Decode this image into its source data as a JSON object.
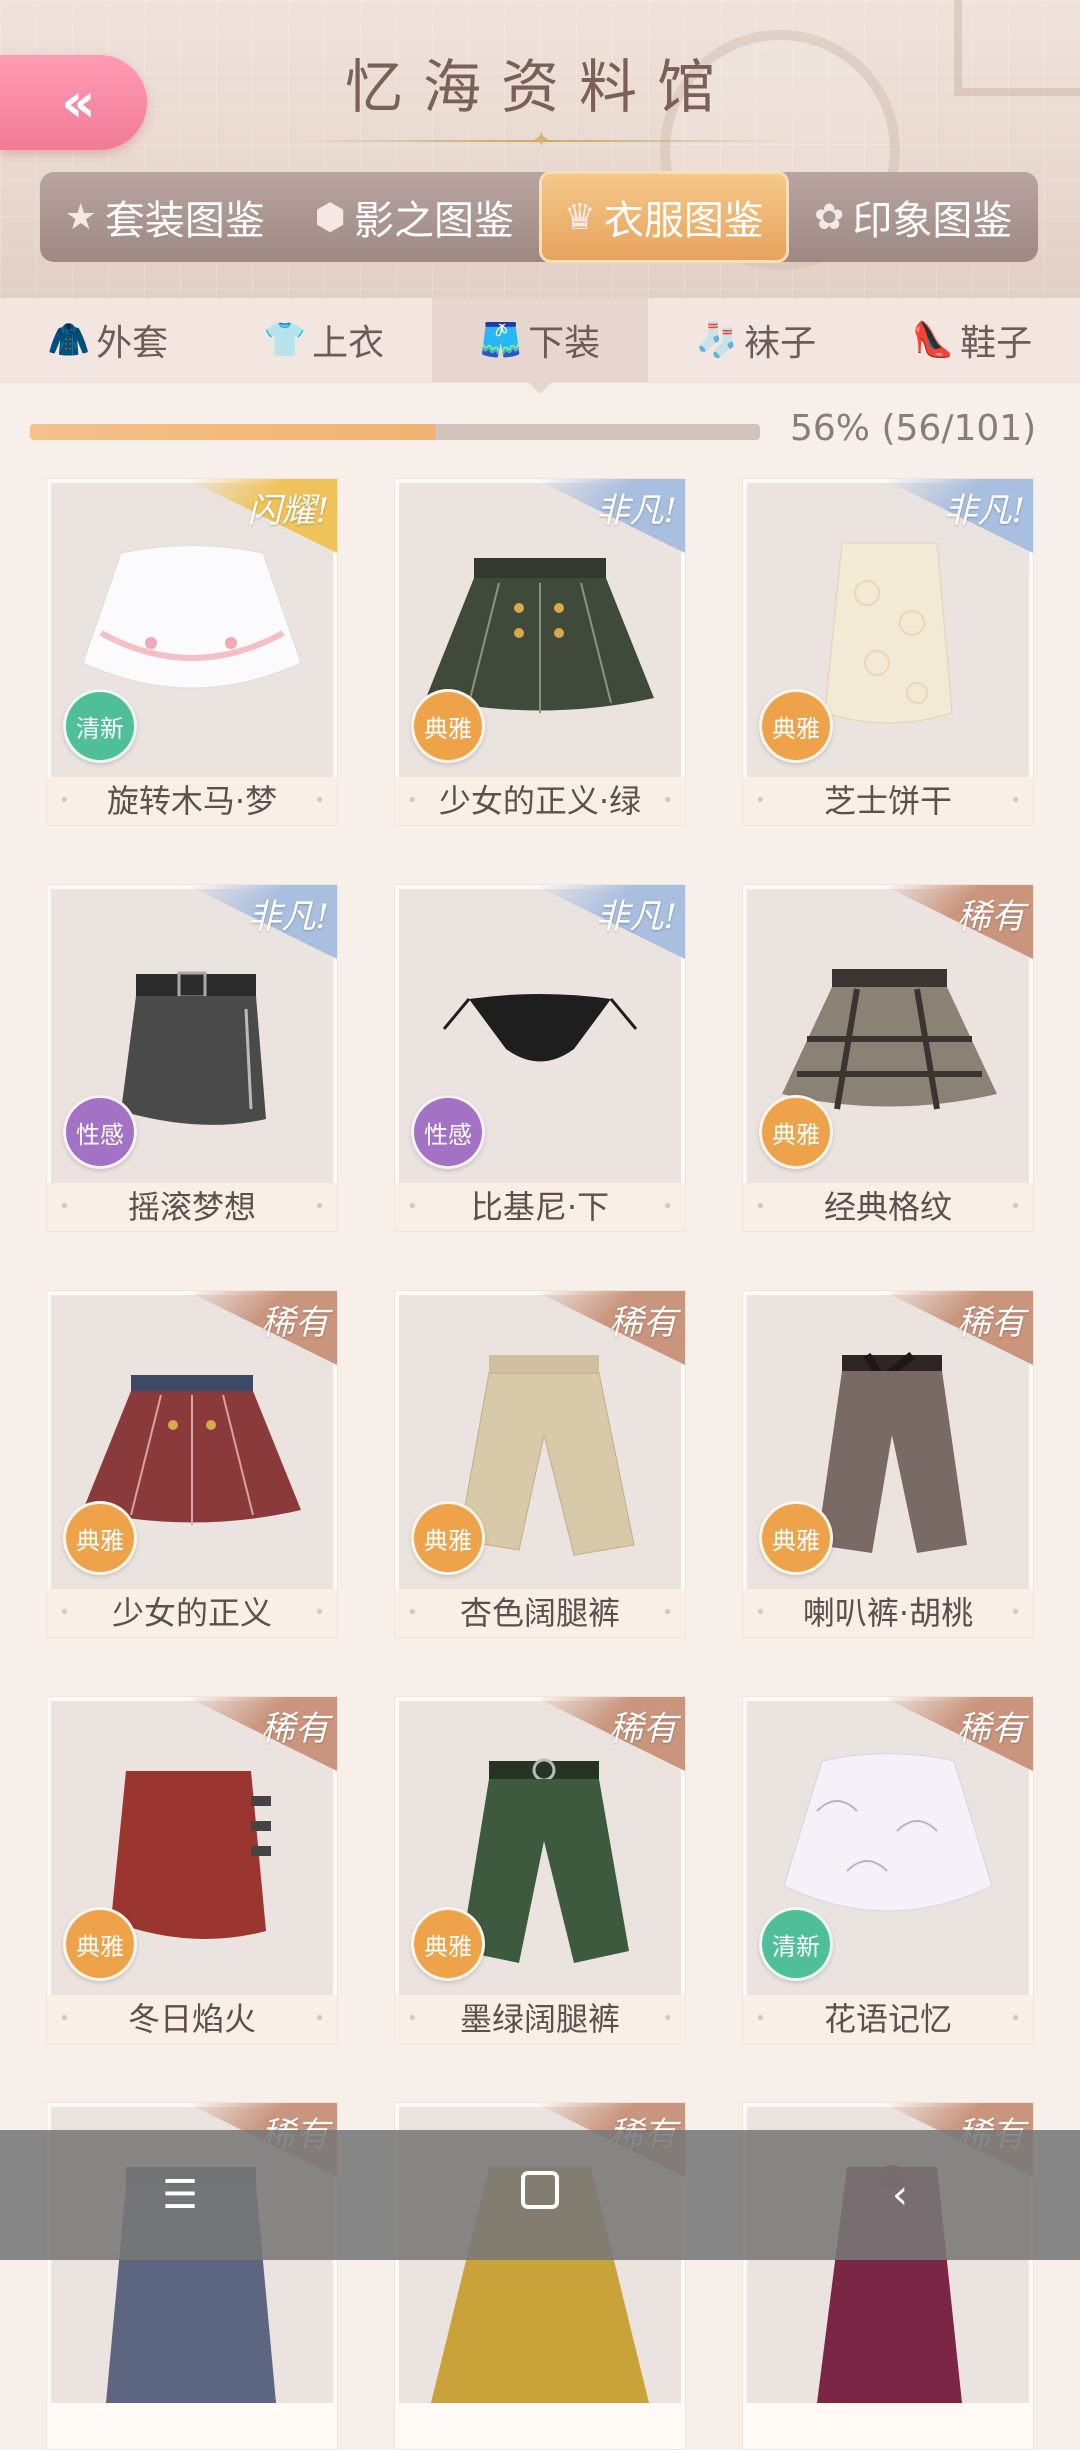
{
  "header": {
    "title": "忆海资料馆",
    "back_icon": "double-chevron-left-icon"
  },
  "category_tabs": [
    {
      "label": "套装图鉴",
      "icon": "star-icon",
      "active": false
    },
    {
      "label": "影之图鉴",
      "icon": "cube-icon",
      "active": false
    },
    {
      "label": "衣服图鉴",
      "icon": "dress-icon",
      "active": true
    },
    {
      "label": "印象图鉴",
      "icon": "flower-icon",
      "active": false
    }
  ],
  "sub_tabs": [
    {
      "label": "外套",
      "icon": "coat-icon"
    },
    {
      "label": "上衣",
      "icon": "shirt-icon"
    },
    {
      "label": "下装",
      "icon": "shorts-icon",
      "active": true
    },
    {
      "label": "袜子",
      "icon": "sock-icon"
    },
    {
      "label": "鞋子",
      "icon": "shoe-icon"
    }
  ],
  "progress": {
    "text": "56% (56/101)",
    "fraction": 0.5545
  },
  "items": [
    {
      "name": "旋转木马·梦",
      "rarity": "闪耀!",
      "style": "清新"
    },
    {
      "name": "少女的正义·绿",
      "rarity": "非凡!",
      "style": "典雅"
    },
    {
      "name": "芝士饼干",
      "rarity": "非凡!",
      "style": "典雅"
    },
    {
      "name": "摇滚梦想",
      "rarity": "非凡!",
      "style": "性感"
    },
    {
      "name": "比基尼·下",
      "rarity": "非凡!",
      "style": "性感"
    },
    {
      "name": "经典格纹",
      "rarity": "稀有",
      "style": "典雅"
    },
    {
      "name": "少女的正义",
      "rarity": "稀有",
      "style": "典雅"
    },
    {
      "name": "杏色阔腿裤",
      "rarity": "稀有",
      "style": "典雅"
    },
    {
      "name": "喇叭裤·胡桃",
      "rarity": "稀有",
      "style": "典雅"
    },
    {
      "name": "冬日焰火",
      "rarity": "稀有",
      "style": "典雅"
    },
    {
      "name": "墨绿阔腿裤",
      "rarity": "稀有",
      "style": "典雅"
    },
    {
      "name": "花语记忆",
      "rarity": "稀有",
      "style": "清新"
    },
    {
      "name": "",
      "rarity": "稀有",
      "style": ""
    },
    {
      "name": "",
      "rarity": "稀有",
      "style": ""
    },
    {
      "name": "",
      "rarity": "稀有",
      "style": ""
    }
  ],
  "colors": {
    "rarity_shine": "#f0c35a",
    "rarity_extraordinary": "#a9bfe0",
    "rarity_rare": "#c9957c",
    "style_fresh": "#4fbf9a",
    "style_elegant": "#eea34a",
    "style_sexy": "#a472c4"
  },
  "navbar": {
    "menu_icon": "menu-icon",
    "home_icon": "home-icon",
    "back_icon": "back-icon"
  }
}
